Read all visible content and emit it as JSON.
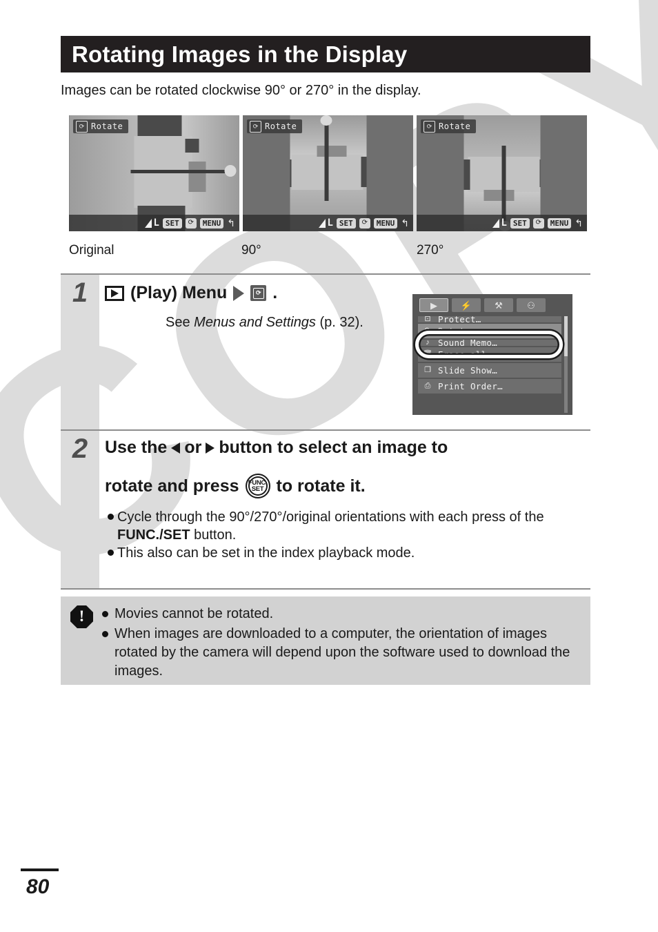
{
  "page": {
    "title": "Rotating Images in the Display",
    "intro": "Images can be rotated clockwise 90° or 270° in the display.",
    "number": "80"
  },
  "lcd_previews": [
    {
      "tag_icon": "rotate-icon",
      "tag_label": "Rotate",
      "caption": "Original",
      "orientation": "sideways",
      "bottom_bar": {
        "quality": "L",
        "set_label": "SET",
        "rotate_icon": "rotate-icon",
        "menu_label": "MENU",
        "return_icon": "return-arrow-icon"
      }
    },
    {
      "tag_icon": "rotate-icon",
      "tag_label": "Rotate",
      "caption": "90°",
      "orientation": "upright-portrait",
      "bottom_bar": {
        "quality": "L",
        "set_label": "SET",
        "rotate_icon": "rotate-icon",
        "menu_label": "MENU",
        "return_icon": "return-arrow-icon"
      }
    },
    {
      "tag_icon": "rotate-icon",
      "tag_label": "Rotate",
      "caption": "270°",
      "orientation": "upside-down-portrait",
      "bottom_bar": {
        "quality": "L",
        "set_label": "SET",
        "rotate_icon": "rotate-icon",
        "menu_label": "MENU",
        "return_icon": "return-arrow-icon"
      }
    }
  ],
  "steps": [
    {
      "number": "1",
      "heading_play": "(Play) Menu",
      "heading_period": ".",
      "see_prefix": "See ",
      "see_italic": "Menus and Settings",
      "see_suffix": " (p. 32)."
    },
    {
      "number": "2",
      "line1_a": "Use the",
      "line1_or": "or",
      "line1_b": "button to select an image to",
      "line2_a": "rotate and press",
      "line2_b": "to rotate it.",
      "func_set_top": "FUNC.",
      "func_set_bottom": "SET",
      "bullets": [
        {
          "pre": "Cycle through the 90°/270°/original orientations with each press of the ",
          "bold": "FUNC./SET",
          "post": " button."
        },
        {
          "pre": "This also can be set in the index playback mode.",
          "bold": "",
          "post": ""
        }
      ]
    }
  ],
  "menu_screenshot": {
    "tabs": [
      {
        "name": "play-tab",
        "glyph": "▶",
        "active": true
      },
      {
        "name": "flash-tab",
        "glyph": "⚡",
        "active": false
      },
      {
        "name": "setup-tab",
        "glyph": "⚒",
        "active": false
      },
      {
        "name": "my-camera-tab",
        "glyph": "⚇",
        "active": false
      }
    ],
    "items": [
      {
        "icon": "protect-icon",
        "label": "Protect…",
        "selected": false,
        "clipped": true
      },
      {
        "icon": "rotate-icon",
        "label": "Rotate…",
        "selected": true,
        "clipped": false
      },
      {
        "icon": "sound-memo-icon",
        "label": "Sound Memo…",
        "selected": false,
        "clipped": true
      },
      {
        "icon": "erase-all-icon",
        "label": "Erase all…",
        "selected": false,
        "clipped": false
      },
      {
        "icon": "slide-show-icon",
        "label": "Slide Show…",
        "selected": false,
        "clipped": false
      },
      {
        "icon": "print-order-icon",
        "label": "Print Order…",
        "selected": false,
        "clipped": false
      }
    ],
    "highlight": "rotate-menu-item-callout"
  },
  "note_box": {
    "icon": "warning-icon",
    "items": [
      "Movies cannot be rotated.",
      "When images are downloaded to a computer, the orientation of images rotated by the camera will depend upon the software used to download the images."
    ]
  },
  "watermark": {
    "text": "COPY"
  },
  "colors": {
    "title_bar": "#231f20",
    "step_column": "#dcdcdc",
    "note_bg": "#d2d2d2",
    "rule": "#8c8c8c",
    "watermark": "#dcdcdc"
  }
}
